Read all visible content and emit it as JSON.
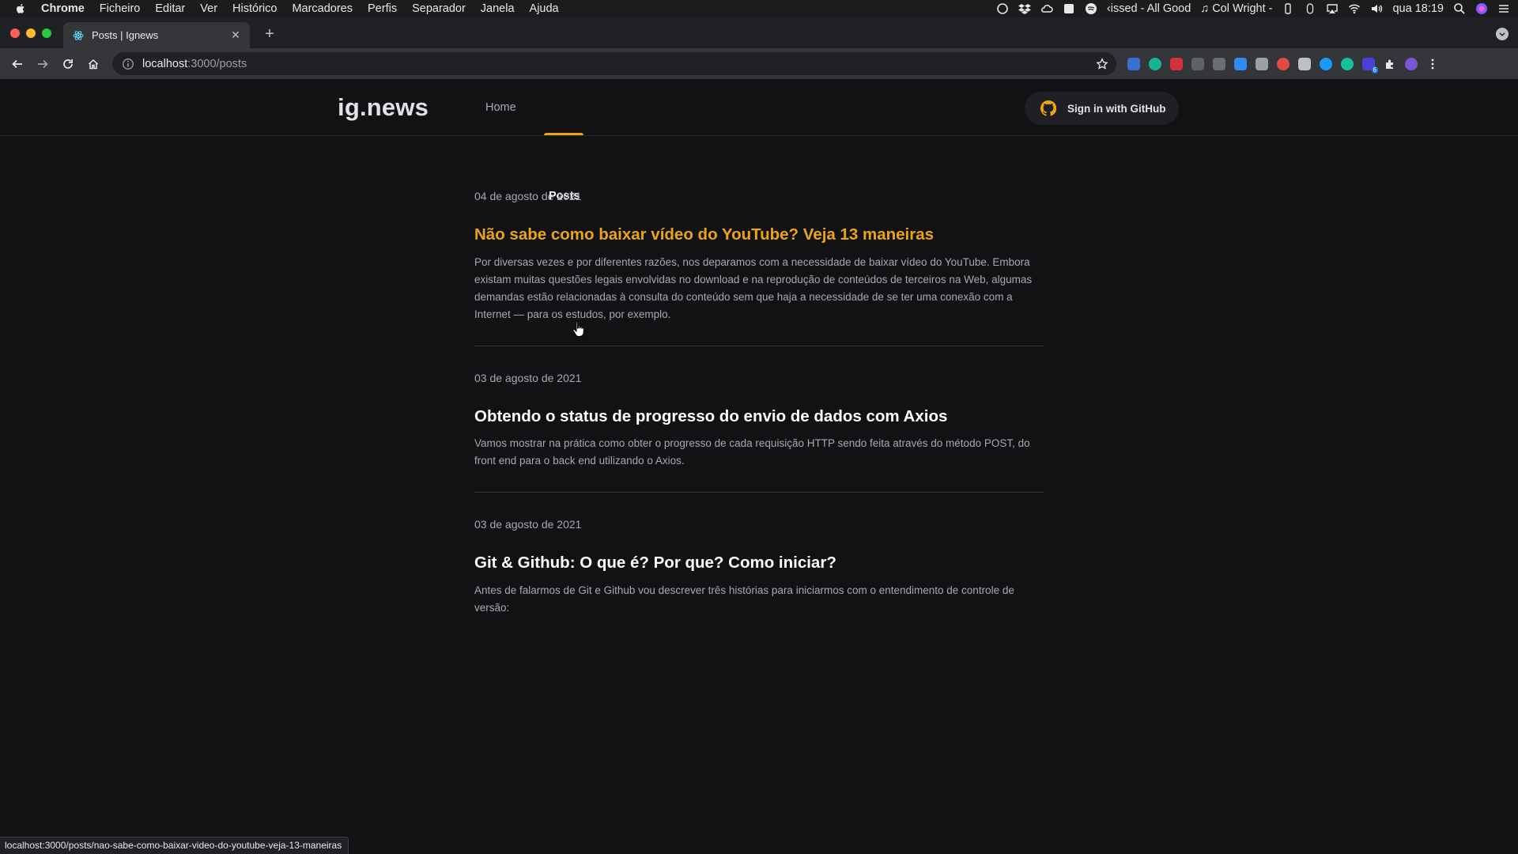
{
  "menubar": {
    "app_name": "Chrome",
    "items": [
      "Ficheiro",
      "Editar",
      "Ver",
      "Histórico",
      "Marcadores",
      "Perfis",
      "Separador",
      "Janela",
      "Ajuda"
    ],
    "now_playing": "‹issed - All Good",
    "music_label": "♫ Col Wright -",
    "clock": "qua 18:19"
  },
  "browser": {
    "tab_title": "Posts | Ignews",
    "url_host": "localhost",
    "url_path": ":3000/posts",
    "status_url": "localhost:3000/posts/nao-sabe-como-baixar-video-do-youtube-veja-13-maneiras",
    "extension_badge": "6"
  },
  "site": {
    "logo": "ig.news",
    "nav": {
      "home": "Home",
      "posts": "Posts"
    },
    "accent_color": "#eba417",
    "signin_label": "Sign in with GitHub"
  },
  "posts": [
    {
      "date": "04 de agosto de 2021",
      "title": "Não sabe como baixar vídeo do YouTube? Veja 13 maneiras",
      "excerpt": "Por diversas vezes e por diferentes razões, nos deparamos com a necessidade de baixar vídeo do YouTube. Embora existam muitas questões legais envolvidas no download e na reprodução de conteúdos de terceiros na Web, algumas demandas estão relacionadas à consulta do conteúdo sem que haja a necessidade de se ter uma conexão com a Internet — para os estudos, por exemplo."
    },
    {
      "date": "03 de agosto de 2021",
      "title": "Obtendo o status de progresso do envio de dados com Axios",
      "excerpt": "Vamos mostrar na prática como obter o progresso de cada requisição HTTP sendo feita através do método POST, do front end para o back end utilizando o Axios."
    },
    {
      "date": "03 de agosto de 2021",
      "title": "Git & Github: O que é? Por que? Como iniciar?",
      "excerpt": "Antes de falarmos de Git e Github vou descrever três histórias para iniciarmos com o entendimento de controle de versão:"
    }
  ]
}
